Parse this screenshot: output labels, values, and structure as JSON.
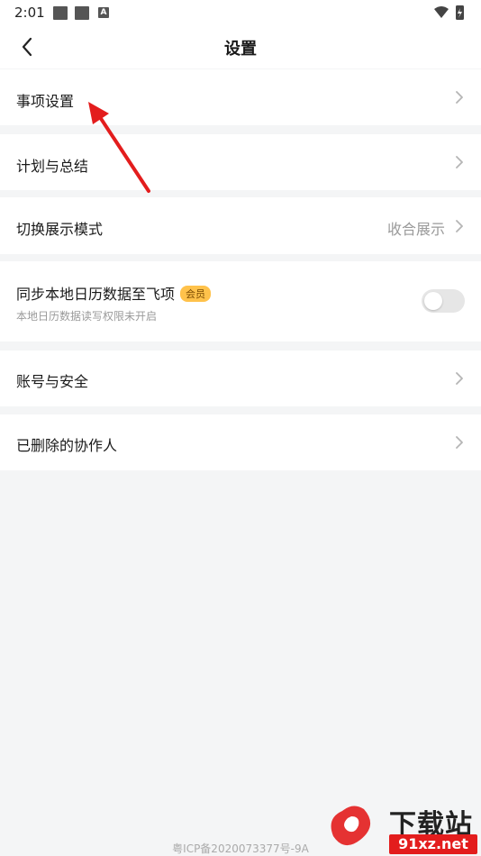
{
  "status_bar": {
    "time": "2:01",
    "extra_label": "A"
  },
  "nav": {
    "title": "设置"
  },
  "settings": {
    "item_settings": {
      "label": "事项设置"
    },
    "plan_summary": {
      "label": "计划与总结"
    },
    "display_mode": {
      "label": "切换展示模式",
      "value": "收合展示"
    },
    "calendar_sync": {
      "label": "同步本地日历数据至飞项",
      "badge": "会员",
      "sub": "本地日历数据读写权限未开启",
      "enabled": false
    },
    "account_security": {
      "label": "账号与安全"
    },
    "deleted_collaborators": {
      "label": "已删除的协作人"
    }
  },
  "footer": {
    "icp": "粤ICP备2020073377号-9A"
  },
  "watermark": {
    "title": "下载站",
    "domain": "91xz.net"
  },
  "colors": {
    "accent_red": "#e31d1d",
    "badge": "#ffc24b",
    "background": "#f4f5f6"
  }
}
